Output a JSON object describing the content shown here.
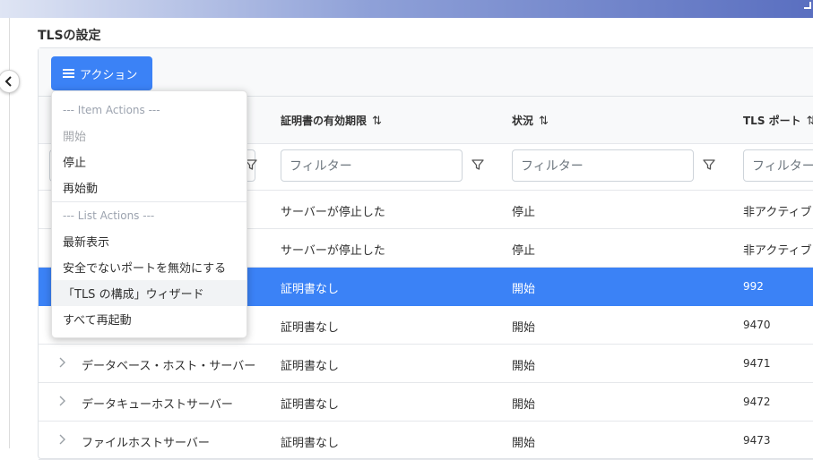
{
  "page": {
    "title": "TLSの設定"
  },
  "toolbar": {
    "action_label": "アクション"
  },
  "columns": {
    "cert_expiry": "証明書の有効期限",
    "status": "状況",
    "tls_port": "TLS ポート",
    "sort_glyph": "⇅"
  },
  "filters": {
    "placeholder": "フィルター"
  },
  "rows": [
    {
      "name": "",
      "cert": "サーバーが停止した",
      "status": "停止",
      "port": "非アクティブ"
    },
    {
      "name": "",
      "cert": "サーバーが停止した",
      "status": "停止",
      "port": "非アクティブ"
    },
    {
      "name": "",
      "cert": "証明書なし",
      "status": "開始",
      "port": "992"
    },
    {
      "name": "",
      "cert": "証明書なし",
      "status": "開始",
      "port": "9470"
    },
    {
      "name": "データベース・ホスト・サーバー",
      "cert": "証明書なし",
      "status": "開始",
      "port": "9471"
    },
    {
      "name": "データキューホストサーバー",
      "cert": "証明書なし",
      "status": "開始",
      "port": "9472"
    },
    {
      "name": "ファイルホストサーバー",
      "cert": "証明書なし",
      "status": "開始",
      "port": "9473"
    }
  ],
  "menu": {
    "item_header": "--- Item Actions ---",
    "start": "開始",
    "stop": "停止",
    "restart": "再始動",
    "list_header": "--- List Actions ---",
    "refresh": "最新表示",
    "disable_insecure": "安全でないポートを無効にする",
    "tls_wizard": "「TLS の構成」ウィザード",
    "restart_all": "すべて再起動"
  },
  "colors": {
    "accent": "#3b82f6",
    "selected_row": "#3b82f6"
  },
  "icons": {
    "menu": "hamburger-icon",
    "filter": "filter-icon",
    "expand": "chevron-right-icon",
    "collapse": "chevron-left-icon"
  }
}
